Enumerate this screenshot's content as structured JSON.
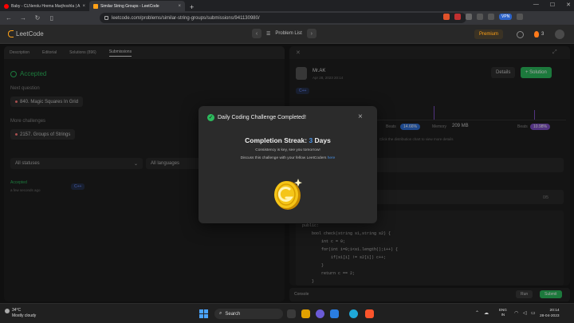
{
  "browser": {
    "tabs": [
      {
        "label": "Baby - CLNerolu Hrema Marjhoshla | A",
        "active": false
      },
      {
        "label": "Similar String Groups - LeetCode",
        "active": true
      }
    ],
    "new_tab": "+",
    "url": "leetcode.com/problems/similar-string-groups/submissions/941130980/",
    "vpn": "VPN"
  },
  "header": {
    "logo": "LeetCode",
    "problem_list": "Problem List",
    "premium": "Premium",
    "streak_count": "3"
  },
  "left": {
    "tabs": [
      "Description",
      "Editorial",
      "Solutions (896)",
      "Submissions"
    ],
    "status": "Accepted",
    "next_question_label": "Next question",
    "next_question": "840. Magic Squares In Grid",
    "more_label": "More challenges",
    "more_challenge": "2157. Groups of Strings",
    "filter_status": "All statuses",
    "filter_lang": "All languages",
    "submission_status": "Accepted",
    "submission_time": "a few seconds ago",
    "submission_lang": "C++"
  },
  "right": {
    "user": "Mr.AK",
    "date": "Apr 28, 2023 20:14",
    "lang": "C++",
    "details": "Details",
    "solution": "+ Solution",
    "runtime_label": "Beats",
    "runtime_beats": "14.66%",
    "memory_label": "Memory",
    "memory_value": "209 MB",
    "memory_beats_label": "Beats",
    "memory_beats": "10.98%",
    "hint": "Click the distribution chart to view more details",
    "pager": "0/5",
    "code": [
      "class Solution {",
      "public:",
      "    bool check(string s1,string s2) {",
      "        int c = 0;",
      "        for(int i=0;i<s1.length();i++) {",
      "            if(s1[i] != s2[i]) c++;",
      "        }",
      "        return c == 2;",
      "    }"
    ],
    "console": "Console",
    "run": "Run",
    "submit": "Submit"
  },
  "modal": {
    "title": "Daily Coding Challenge Completed!",
    "streak_label": "Completion Streak:",
    "streak_num": "3",
    "streak_unit": "Days",
    "subtitle": "Consistency is key, see you tomorrow!",
    "share_text": "Discuss this challenge with your fellow LeetCoders",
    "share_link": "here",
    "close": "×"
  },
  "taskbar": {
    "temp": "34°C",
    "weather": "Mostly cloudy",
    "search": "Search",
    "lang_top": "ENG",
    "lang_bottom": "IN",
    "time": "20:14",
    "date": "28-04-2023"
  }
}
